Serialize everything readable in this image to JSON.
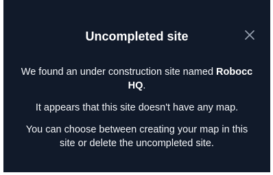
{
  "dialog": {
    "title": "Uncompleted site",
    "close_icon": "close-icon",
    "paragraph_1_before": "We found an under construction site named ",
    "site_name": "Robocc HQ",
    "paragraph_1_after": ".",
    "paragraph_2": "It appears that this site doesn't have any map.",
    "paragraph_3": "You can choose between creating your map in this site or delete the uncompleted site."
  },
  "colors": {
    "background": "#111a2a",
    "text": "#f2f4f7",
    "icon": "#9aa3b2"
  }
}
